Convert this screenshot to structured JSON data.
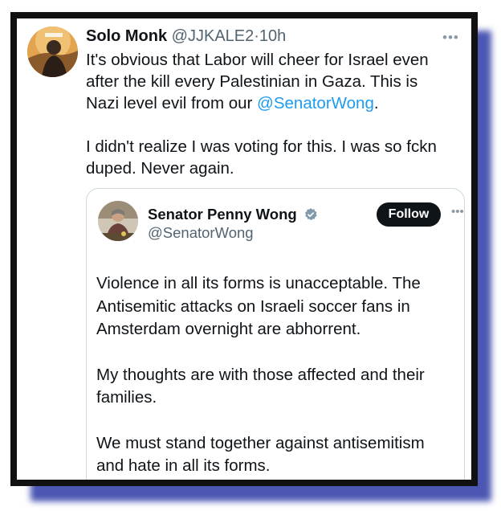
{
  "tweet": {
    "author_name": "Solo Monk",
    "author_handle": "@JJKALE2",
    "separator": "·",
    "time": "10h",
    "more_icon": "ellipsis-icon",
    "text_lines": [
      "It's obvious that Labor will cheer for Israel even",
      "after the kill every Palestinian in Gaza. This is",
      "Nazi level evil from our "
    ],
    "mention": "@SenatorWong",
    "mention_suffix": ".",
    "text2_lines": [
      "I didn't realize I was voting for this. I was so fckn",
      "duped. Never again."
    ]
  },
  "quoted": {
    "author_name": "Senator Penny Wong",
    "author_handle": "@SenatorWong",
    "verified_icon": "verified-badge-icon",
    "follow_label": "Follow",
    "more_icon": "ellipsis-icon",
    "para1_lines": [
      "Violence in all its forms is unacceptable. The",
      "Antisemitic attacks on Israeli soccer fans in",
      "Amsterdam overnight are abhorrent."
    ],
    "para2_lines": [
      "My thoughts are with those affected and their",
      "families."
    ],
    "para3_lines": [
      "We must stand together against antisemitism",
      "and hate in all its forms."
    ]
  },
  "colors": {
    "link": "#1d9bf0",
    "secondary_text": "#536471",
    "border_shadow": "#4b57b3",
    "follow_button": "#0f1419"
  }
}
